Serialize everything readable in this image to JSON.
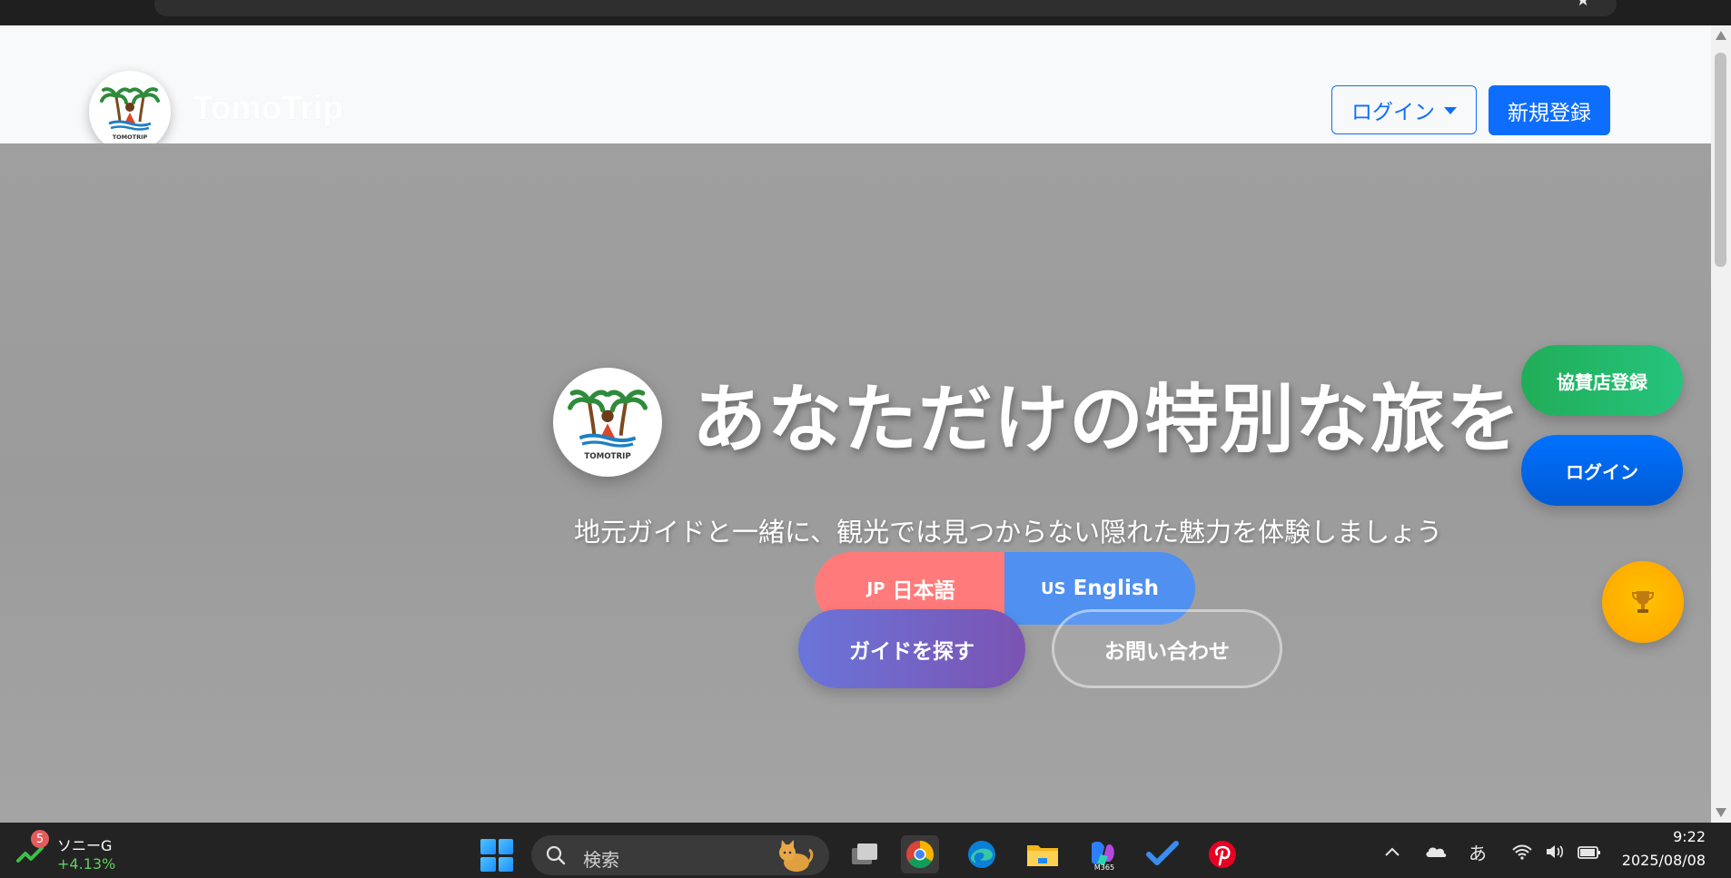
{
  "browser": {
    "star_glyph": "★"
  },
  "navbar": {
    "brand_name": "TomoTrip",
    "login_label": "ログイン",
    "register_label": "新規登録"
  },
  "hero": {
    "title": "あなただけの特別な旅を",
    "subtitle": "地元ガイドと一緒に、観光では見つからない隠れた魅力を体験しましょう",
    "lang_jp_flag": "JP",
    "lang_jp_label": "日本語",
    "lang_en_flag": "US",
    "lang_en_label": "English",
    "find_guide_label": "ガイドを探す",
    "contact_label": "お問い合わせ"
  },
  "floating": {
    "sponsor_label": "協賛店登録",
    "login_label": "ログイン",
    "trophy_icon": "trophy-icon"
  },
  "logo_text": "TOMOTRIP",
  "taskbar": {
    "stock_badge": "5",
    "stock_name": "ソニーG",
    "stock_change": "+4.13%",
    "search_placeholder": "検索",
    "ime": "あ",
    "time": "9:22",
    "date": "2025/08/08"
  },
  "colors": {
    "primary": "#0d6efd",
    "sponsor": "#21ad57",
    "jp_button": "#ff7b7b",
    "en_button": "#4f90f0",
    "trophy": "#ffb000"
  }
}
